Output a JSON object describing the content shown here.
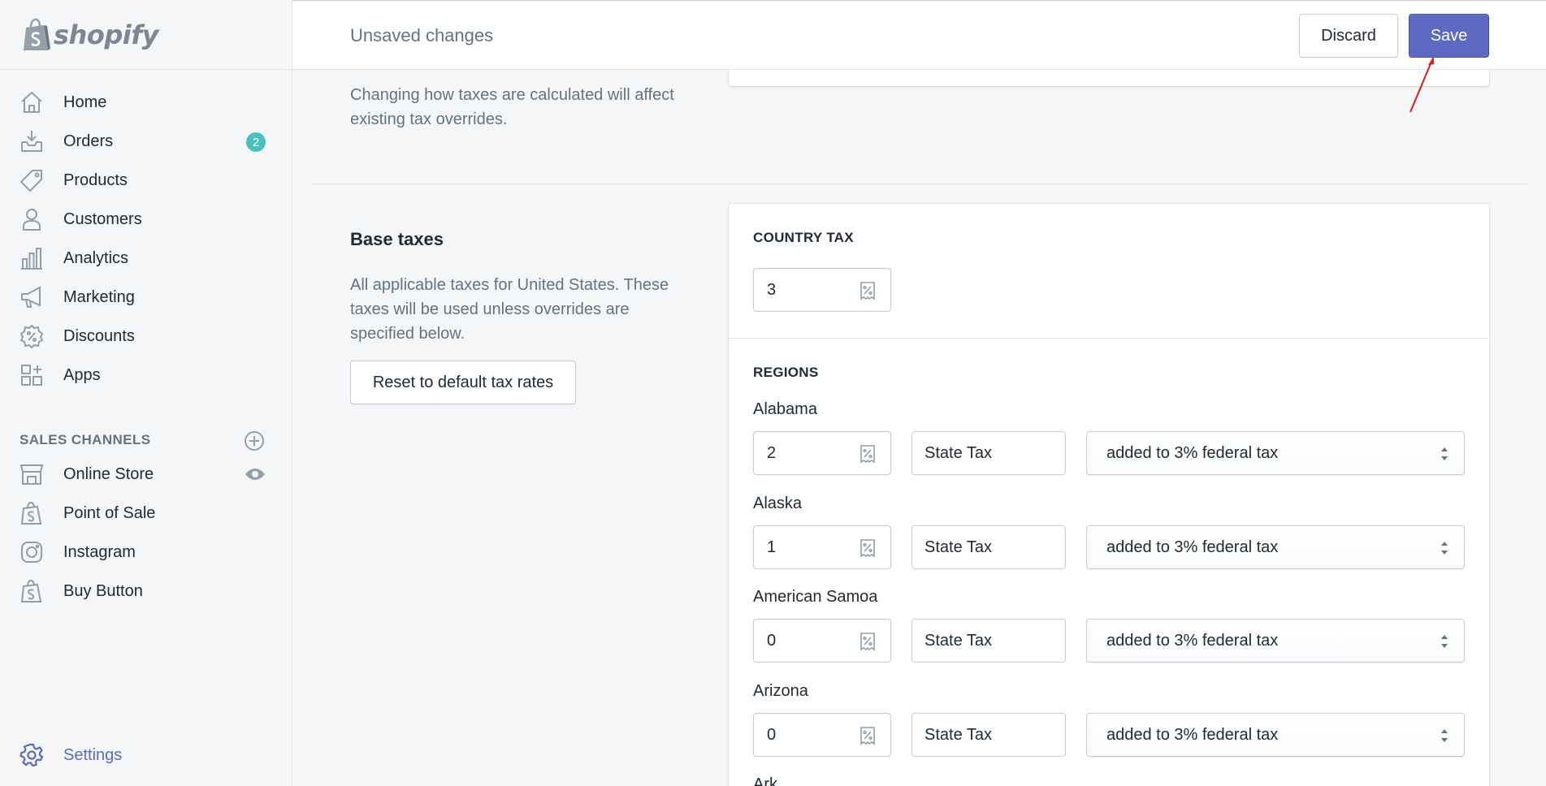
{
  "brand": {
    "name": "shopify"
  },
  "sidebar": {
    "items": [
      {
        "label": "Home",
        "icon": "home-icon"
      },
      {
        "label": "Orders",
        "icon": "orders-icon",
        "badge": "2"
      },
      {
        "label": "Products",
        "icon": "tag-icon"
      },
      {
        "label": "Customers",
        "icon": "person-icon"
      },
      {
        "label": "Analytics",
        "icon": "bar-chart-icon"
      },
      {
        "label": "Marketing",
        "icon": "megaphone-icon"
      },
      {
        "label": "Discounts",
        "icon": "discount-icon"
      },
      {
        "label": "Apps",
        "icon": "apps-icon"
      }
    ],
    "sales_channels_label": "SALES CHANNELS",
    "channels": [
      {
        "label": "Online Store",
        "icon": "store-icon"
      },
      {
        "label": "Point of Sale",
        "icon": "shopify-bag-icon"
      },
      {
        "label": "Instagram",
        "icon": "instagram-icon"
      },
      {
        "label": "Buy Button",
        "icon": "shopify-bag-icon"
      }
    ],
    "settings_label": "Settings"
  },
  "topbar": {
    "title": "Unsaved changes",
    "discard_label": "Discard",
    "save_label": "Save"
  },
  "main": {
    "calc_note": "Changing how taxes are calculated will affect existing tax overrides.",
    "base_taxes": {
      "title": "Base taxes",
      "description": "All applicable taxes for United States. These taxes will be used unless overrides are specified below.",
      "reset_label": "Reset to default tax rates"
    },
    "country_tax": {
      "heading": "COUNTRY TAX",
      "value": "3"
    },
    "regions": {
      "heading": "REGIONS",
      "rows": [
        {
          "name": "Alabama",
          "rate": "2",
          "tax_name": "State Tax",
          "mode": "added to 3% federal tax"
        },
        {
          "name": "Alaska",
          "rate": "1",
          "tax_name": "State Tax",
          "mode": "added to 3% federal tax"
        },
        {
          "name": "American Samoa",
          "rate": "0",
          "tax_name": "State Tax",
          "mode": "added to 3% federal tax"
        },
        {
          "name": "Arizona",
          "rate": "0",
          "tax_name": "State Tax",
          "mode": "added to 3% federal tax"
        }
      ],
      "next_partial": "Ark"
    }
  },
  "colors": {
    "accent": "#5c6ac4",
    "badge": "#47c1bf",
    "annotation_arrow": "#e0191b"
  }
}
